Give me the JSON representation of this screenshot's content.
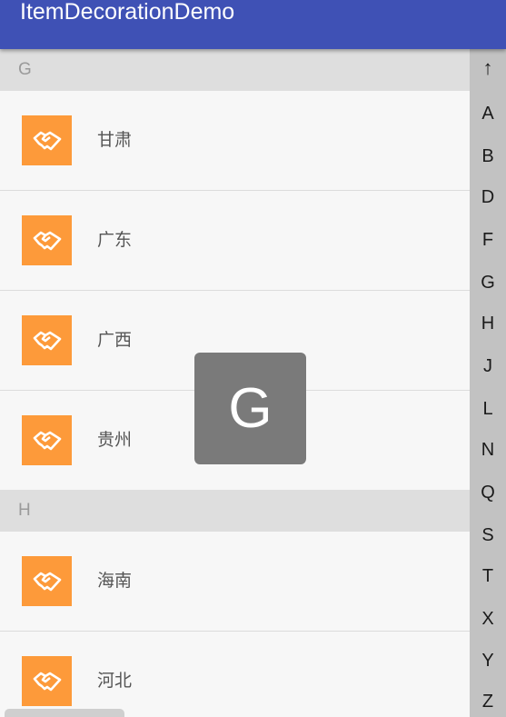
{
  "app": {
    "title": "ItemDecorationDemo"
  },
  "sections": [
    {
      "header": "G",
      "items": [
        {
          "label": "甘肃"
        },
        {
          "label": "广东"
        },
        {
          "label": "广西"
        },
        {
          "label": "贵州"
        }
      ]
    },
    {
      "header": "H",
      "items": [
        {
          "label": "海南"
        },
        {
          "label": "河北"
        }
      ]
    }
  ],
  "index_bar": {
    "letters": [
      "↑",
      "A",
      "B",
      "D",
      "F",
      "G",
      "H",
      "J",
      "L",
      "N",
      "Q",
      "S",
      "T",
      "X",
      "Y",
      "Z"
    ]
  },
  "overlay": {
    "letter": "G"
  },
  "colors": {
    "appbar": "#3f51b5",
    "thumb": "#fd9a3a",
    "header_bg": "#dedede",
    "index_bar_bg": "#c2c2c2",
    "overlay_bg": "#7a7a7a"
  },
  "icons": {
    "item_thumb": "handshake-icon"
  }
}
